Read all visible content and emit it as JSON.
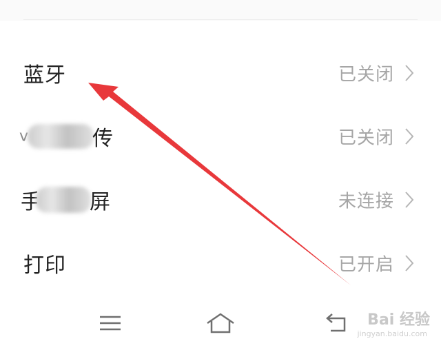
{
  "settings": {
    "rows": [
      {
        "label": "蓝牙",
        "status": "已关闭"
      },
      {
        "label": "传",
        "status": "已关闭"
      },
      {
        "label": "屏",
        "status": "未连接"
      },
      {
        "label": "打印",
        "status": "已开启"
      }
    ],
    "redacted_prefix_row2": "v",
    "redacted_prefix_row3": "手"
  },
  "navbar": {
    "icons": [
      "menu-icon",
      "home-icon",
      "back-icon"
    ]
  },
  "watermark": {
    "text": "Bai 经验",
    "subtext": "jingyan.baidu.com"
  },
  "annotation": {
    "arrow_color": "#e8383b"
  }
}
